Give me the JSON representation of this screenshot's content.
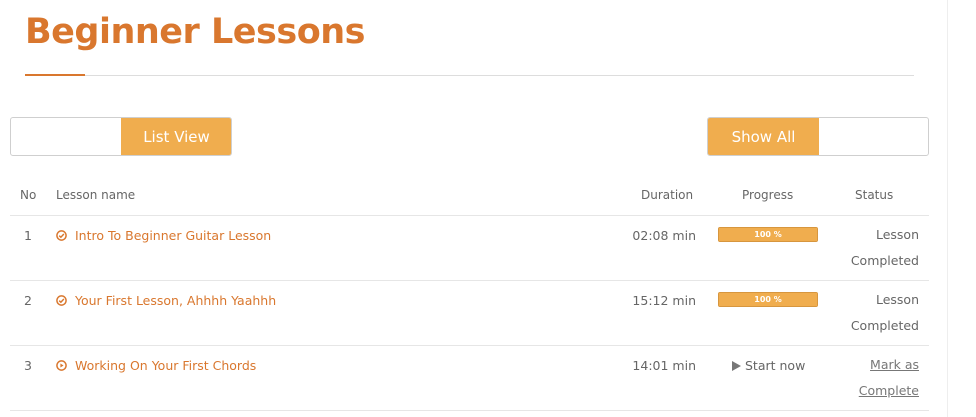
{
  "page": {
    "title": "Beginner Lessons"
  },
  "view_toggle": {
    "active_label": "List View"
  },
  "filter_toggle": {
    "active_label": "Show All"
  },
  "table": {
    "headers": {
      "no": "No",
      "name": "Lesson name",
      "duration": "Duration",
      "progress": "Progress",
      "status": "Status"
    },
    "rows": [
      {
        "no": "1",
        "name": "Intro To Beginner Guitar Lesson",
        "icon": "check-circle-icon",
        "duration": "02:08 min",
        "progress": 1.0,
        "progress_label": "100 %",
        "status_line1": "Lesson",
        "status_line2": "Completed"
      },
      {
        "no": "2",
        "name": "Your First Lesson, Ahhhh Yaahhh",
        "icon": "check-circle-icon",
        "duration": "15:12 min",
        "progress": 1.0,
        "progress_label": "100 %",
        "status_line1": "Lesson",
        "status_line2": "Completed"
      },
      {
        "no": "3",
        "name": "Working On Your First Chords",
        "icon": "play-circle-icon",
        "duration": "14:01 min",
        "start_label": "Start now",
        "status_line1": "Mark as",
        "status_line2": "Complete"
      }
    ]
  },
  "colors": {
    "accent": "#d9772e",
    "button": "#f0ad4e"
  }
}
